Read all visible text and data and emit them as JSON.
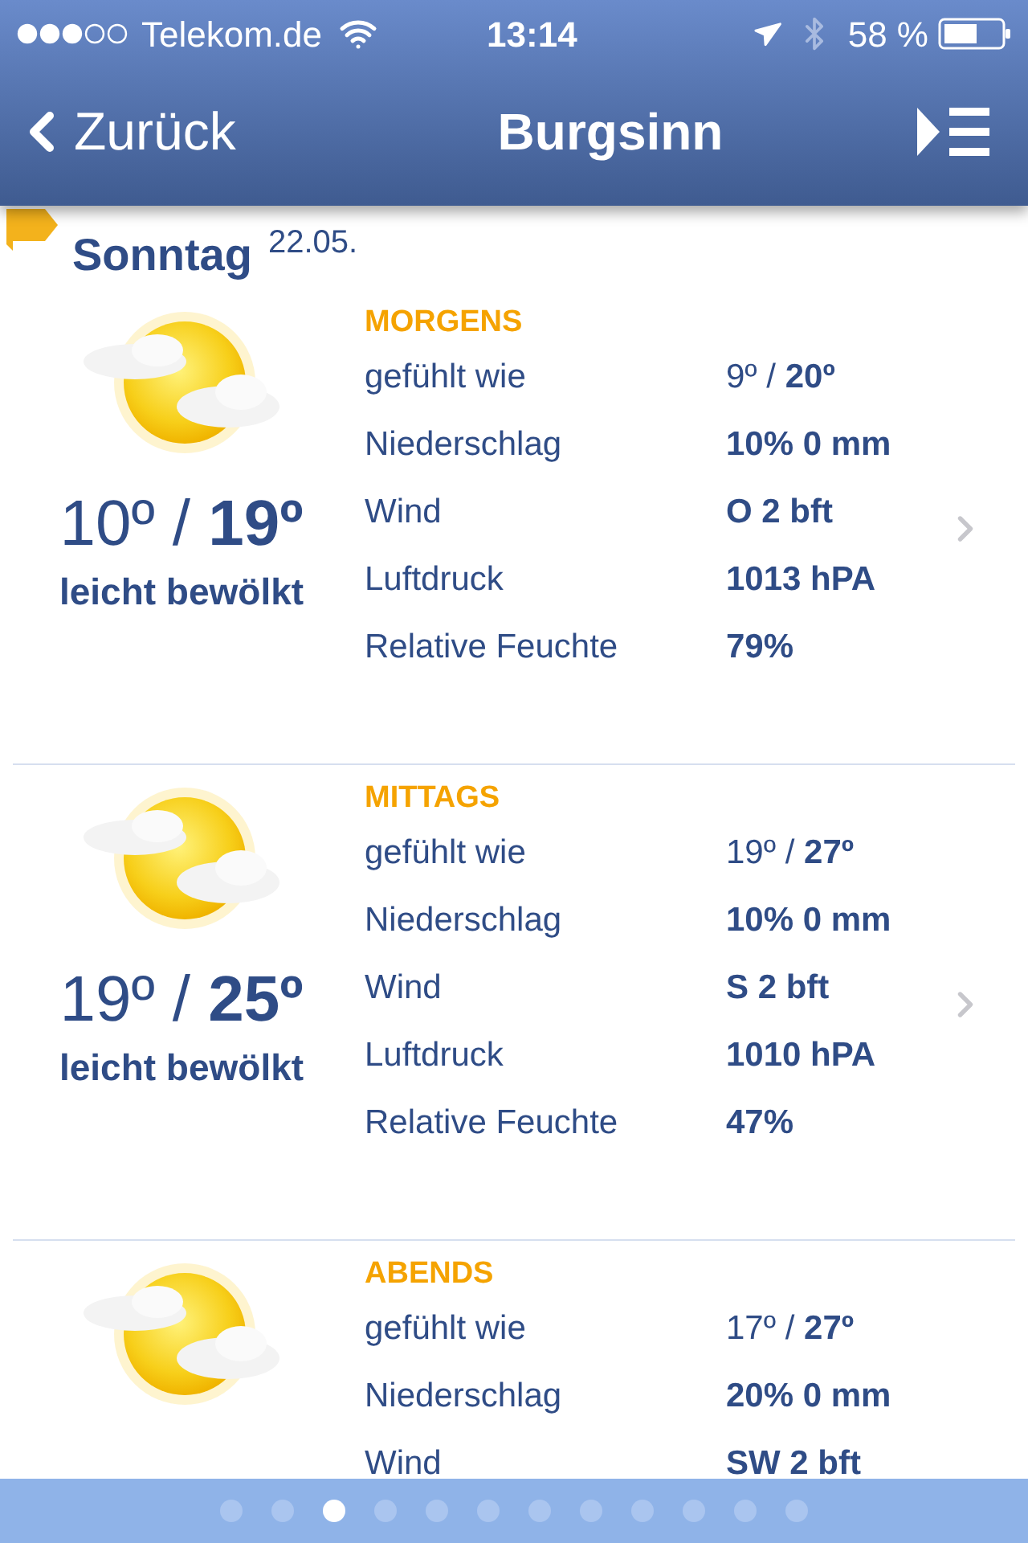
{
  "status_bar": {
    "carrier": "Telekom.de",
    "time": "13:14",
    "battery": "58 %"
  },
  "nav": {
    "back": "Zurück",
    "title": "Burgsinn"
  },
  "day": {
    "name": "Sonntag",
    "date": "22.05."
  },
  "periods": [
    {
      "name": "MORGENS",
      "temperature": "10º / **19º**",
      "condition": "leicht bewölkt",
      "rows": [
        {
          "label": "gefühlt wie",
          "value": "9º / **20º**"
        },
        {
          "label": "Niederschlag",
          "value": "**10% 0 mm**"
        },
        {
          "label": "Wind",
          "value": "**O 2 bft**"
        },
        {
          "label": "Luftdruck",
          "value": "**1013 hPA**"
        },
        {
          "label": "Relative Feuchte",
          "value": "**79%**"
        }
      ]
    },
    {
      "name": "MITTAGS",
      "temperature": "19º / **25º**",
      "condition": "leicht bewölkt",
      "rows": [
        {
          "label": "gefühlt wie",
          "value": "19º / **27º**"
        },
        {
          "label": "Niederschlag",
          "value": "**10% 0 mm**"
        },
        {
          "label": "Wind",
          "value": "**S 2 bft**"
        },
        {
          "label": "Luftdruck",
          "value": "**1010 hPA**"
        },
        {
          "label": "Relative Feuchte",
          "value": "**47%**"
        }
      ]
    },
    {
      "name": "ABENDS",
      "rows": [
        {
          "label": "gefühlt wie",
          "value": "17º / **27º**"
        },
        {
          "label": "Niederschlag",
          "value": "**20% 0 mm**"
        },
        {
          "label": "Wind",
          "value": "**SW 2 bft**"
        }
      ]
    }
  ],
  "pages": [
    {
      "selected": false
    },
    {
      "selected": false
    },
    {
      "selected": true
    },
    {
      "selected": false
    },
    {
      "selected": false
    },
    {
      "selected": false
    },
    {
      "selected": false
    },
    {
      "selected": false
    },
    {
      "selected": false
    },
    {
      "selected": false
    },
    {
      "selected": false
    },
    {
      "selected": false
    }
  ]
}
